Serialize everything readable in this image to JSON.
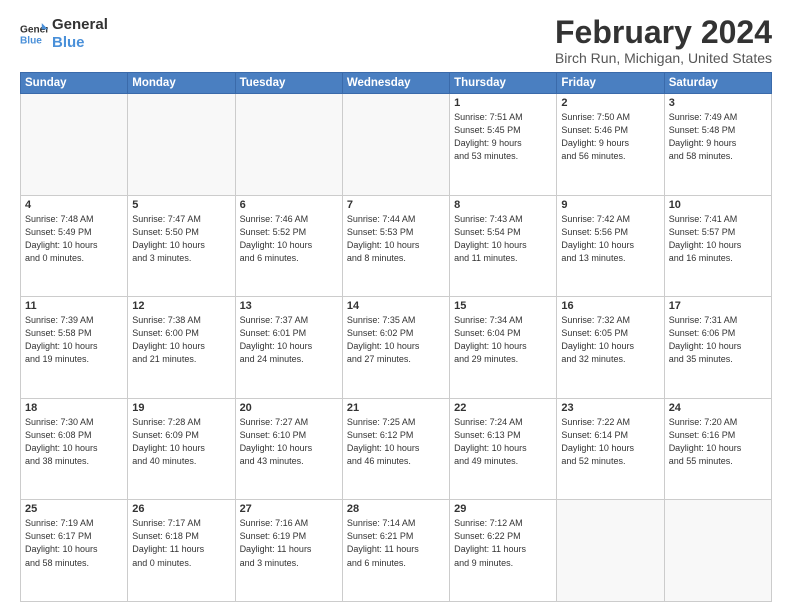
{
  "logo": {
    "line1": "General",
    "line2": "Blue"
  },
  "title": "February 2024",
  "subtitle": "Birch Run, Michigan, United States",
  "weekdays": [
    "Sunday",
    "Monday",
    "Tuesday",
    "Wednesday",
    "Thursday",
    "Friday",
    "Saturday"
  ],
  "weeks": [
    [
      {
        "day": "",
        "info": ""
      },
      {
        "day": "",
        "info": ""
      },
      {
        "day": "",
        "info": ""
      },
      {
        "day": "",
        "info": ""
      },
      {
        "day": "1",
        "info": "Sunrise: 7:51 AM\nSunset: 5:45 PM\nDaylight: 9 hours\nand 53 minutes."
      },
      {
        "day": "2",
        "info": "Sunrise: 7:50 AM\nSunset: 5:46 PM\nDaylight: 9 hours\nand 56 minutes."
      },
      {
        "day": "3",
        "info": "Sunrise: 7:49 AM\nSunset: 5:48 PM\nDaylight: 9 hours\nand 58 minutes."
      }
    ],
    [
      {
        "day": "4",
        "info": "Sunrise: 7:48 AM\nSunset: 5:49 PM\nDaylight: 10 hours\nand 0 minutes."
      },
      {
        "day": "5",
        "info": "Sunrise: 7:47 AM\nSunset: 5:50 PM\nDaylight: 10 hours\nand 3 minutes."
      },
      {
        "day": "6",
        "info": "Sunrise: 7:46 AM\nSunset: 5:52 PM\nDaylight: 10 hours\nand 6 minutes."
      },
      {
        "day": "7",
        "info": "Sunrise: 7:44 AM\nSunset: 5:53 PM\nDaylight: 10 hours\nand 8 minutes."
      },
      {
        "day": "8",
        "info": "Sunrise: 7:43 AM\nSunset: 5:54 PM\nDaylight: 10 hours\nand 11 minutes."
      },
      {
        "day": "9",
        "info": "Sunrise: 7:42 AM\nSunset: 5:56 PM\nDaylight: 10 hours\nand 13 minutes."
      },
      {
        "day": "10",
        "info": "Sunrise: 7:41 AM\nSunset: 5:57 PM\nDaylight: 10 hours\nand 16 minutes."
      }
    ],
    [
      {
        "day": "11",
        "info": "Sunrise: 7:39 AM\nSunset: 5:58 PM\nDaylight: 10 hours\nand 19 minutes."
      },
      {
        "day": "12",
        "info": "Sunrise: 7:38 AM\nSunset: 6:00 PM\nDaylight: 10 hours\nand 21 minutes."
      },
      {
        "day": "13",
        "info": "Sunrise: 7:37 AM\nSunset: 6:01 PM\nDaylight: 10 hours\nand 24 minutes."
      },
      {
        "day": "14",
        "info": "Sunrise: 7:35 AM\nSunset: 6:02 PM\nDaylight: 10 hours\nand 27 minutes."
      },
      {
        "day": "15",
        "info": "Sunrise: 7:34 AM\nSunset: 6:04 PM\nDaylight: 10 hours\nand 29 minutes."
      },
      {
        "day": "16",
        "info": "Sunrise: 7:32 AM\nSunset: 6:05 PM\nDaylight: 10 hours\nand 32 minutes."
      },
      {
        "day": "17",
        "info": "Sunrise: 7:31 AM\nSunset: 6:06 PM\nDaylight: 10 hours\nand 35 minutes."
      }
    ],
    [
      {
        "day": "18",
        "info": "Sunrise: 7:30 AM\nSunset: 6:08 PM\nDaylight: 10 hours\nand 38 minutes."
      },
      {
        "day": "19",
        "info": "Sunrise: 7:28 AM\nSunset: 6:09 PM\nDaylight: 10 hours\nand 40 minutes."
      },
      {
        "day": "20",
        "info": "Sunrise: 7:27 AM\nSunset: 6:10 PM\nDaylight: 10 hours\nand 43 minutes."
      },
      {
        "day": "21",
        "info": "Sunrise: 7:25 AM\nSunset: 6:12 PM\nDaylight: 10 hours\nand 46 minutes."
      },
      {
        "day": "22",
        "info": "Sunrise: 7:24 AM\nSunset: 6:13 PM\nDaylight: 10 hours\nand 49 minutes."
      },
      {
        "day": "23",
        "info": "Sunrise: 7:22 AM\nSunset: 6:14 PM\nDaylight: 10 hours\nand 52 minutes."
      },
      {
        "day": "24",
        "info": "Sunrise: 7:20 AM\nSunset: 6:16 PM\nDaylight: 10 hours\nand 55 minutes."
      }
    ],
    [
      {
        "day": "25",
        "info": "Sunrise: 7:19 AM\nSunset: 6:17 PM\nDaylight: 10 hours\nand 58 minutes."
      },
      {
        "day": "26",
        "info": "Sunrise: 7:17 AM\nSunset: 6:18 PM\nDaylight: 11 hours\nand 0 minutes."
      },
      {
        "day": "27",
        "info": "Sunrise: 7:16 AM\nSunset: 6:19 PM\nDaylight: 11 hours\nand 3 minutes."
      },
      {
        "day": "28",
        "info": "Sunrise: 7:14 AM\nSunset: 6:21 PM\nDaylight: 11 hours\nand 6 minutes."
      },
      {
        "day": "29",
        "info": "Sunrise: 7:12 AM\nSunset: 6:22 PM\nDaylight: 11 hours\nand 9 minutes."
      },
      {
        "day": "",
        "info": ""
      },
      {
        "day": "",
        "info": ""
      }
    ]
  ]
}
